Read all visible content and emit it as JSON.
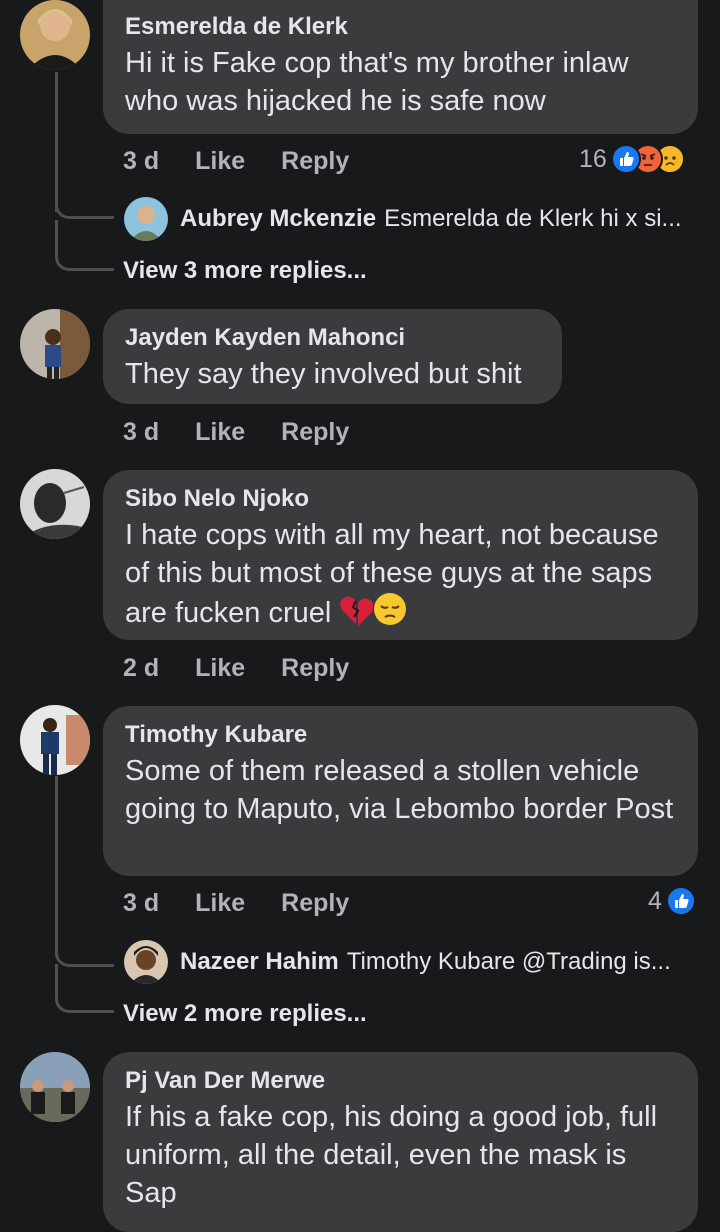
{
  "colors": {
    "background": "#18191a",
    "bubble": "#3a3b3c",
    "primary_text": "#e4e6eb",
    "secondary_text": "#b0b3b8",
    "like_blue": "#1877f2",
    "angry_orange": "#f0643c",
    "sad_yellow": "#f7b928"
  },
  "comments": [
    {
      "author": "Esmerelda de Klerk",
      "text": "Hi it is Fake cop that's my brother inlaw who was hijacked  he is safe now",
      "time": "3 d",
      "like": "Like",
      "reply": "Reply",
      "reaction_count": "16",
      "reaction_icons": [
        "like-icon",
        "angry-icon",
        "sad-icon"
      ],
      "reply_preview": {
        "author": "Aubrey Mckenzie",
        "snippet": "Esmerelda de Klerk hi x si..."
      },
      "more_replies": "View 3 more replies..."
    },
    {
      "author": "Jayden Kayden Mahonci",
      "text": "They say they involved but shit",
      "time": "3 d",
      "like": "Like",
      "reply": "Reply"
    },
    {
      "author": "Sibo Nelo Njoko",
      "text": "I hate cops with all my heart, not because of this but most of these guys at the saps are fucken cruel",
      "emojis": [
        "broken-heart-emoji",
        "pensive-face-emoji"
      ],
      "time": "2 d",
      "like": "Like",
      "reply": "Reply"
    },
    {
      "author": "Timothy Kubare",
      "text": "Some of them released a stollen vehicle going to Maputo, via Lebombo border Post",
      "time": "3 d",
      "like": "Like",
      "reply": "Reply",
      "reaction_count": "4",
      "reaction_icons": [
        "like-icon"
      ],
      "reply_preview": {
        "author": "Nazeer Hahim",
        "snippet": "Timothy Kubare @Trading is..."
      },
      "more_replies": "View 2 more replies..."
    },
    {
      "author": "Pj Van Der Merwe",
      "text": "If his a fake cop, his doing a good job, full uniform, all the detail, even the mask is Sap"
    }
  ]
}
